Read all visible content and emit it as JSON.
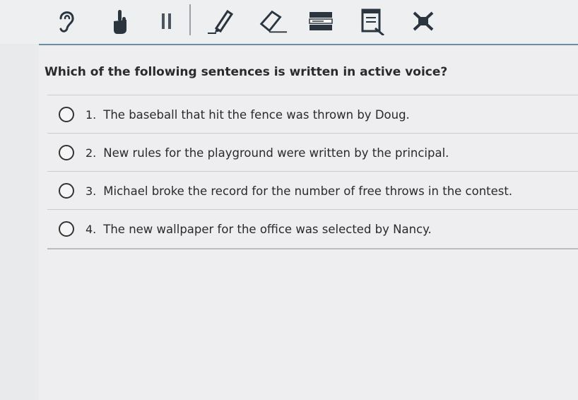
{
  "toolbar": {
    "tools": [
      {
        "name": "ear-icon"
      },
      {
        "name": "hand-pointer-icon"
      },
      {
        "name": "pause-icon"
      },
      {
        "name": "pencil-icon"
      },
      {
        "name": "eraser-icon"
      },
      {
        "name": "line-reader-icon"
      },
      {
        "name": "notepad-icon"
      },
      {
        "name": "answer-eliminator-icon"
      }
    ]
  },
  "question": {
    "text": "Which of the following sentences is written in active voice?"
  },
  "choices": [
    {
      "number": "1.",
      "text": "The baseball that hit the fence was thrown by Doug."
    },
    {
      "number": "2.",
      "text": "New rules for the playground were written by the principal."
    },
    {
      "number": "3.",
      "text": "Michael broke the record for the number of free throws in the contest."
    },
    {
      "number": "4.",
      "text": "The new wallpaper for the office was selected by Nancy."
    }
  ]
}
